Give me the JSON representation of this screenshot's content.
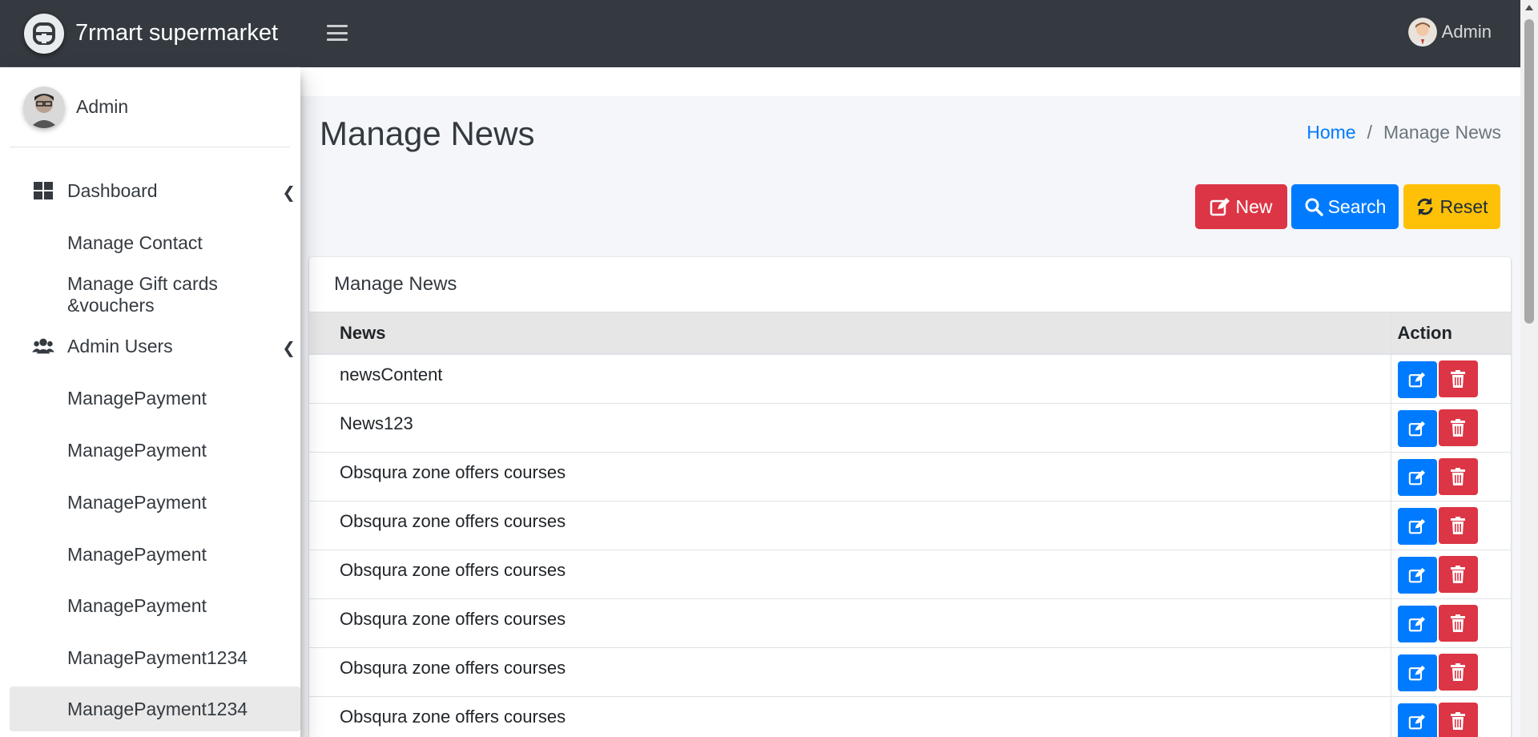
{
  "app": {
    "brand": "7rmart supermarket"
  },
  "topnav": {
    "user": "Admin"
  },
  "sidebar": {
    "user": "Admin",
    "items": [
      {
        "label": "Dashboard",
        "icon": "dashboard-icon",
        "has_children": true
      },
      {
        "label": "Manage Contact"
      },
      {
        "label": "Manage Gift cards &vouchers"
      },
      {
        "label": "Admin Users",
        "icon": "users-icon",
        "has_children": true
      },
      {
        "label": "ManagePayment"
      },
      {
        "label": "ManagePayment"
      },
      {
        "label": "ManagePayment"
      },
      {
        "label": "ManagePayment"
      },
      {
        "label": "ManagePayment"
      },
      {
        "label": "ManagePayment1234"
      },
      {
        "label": "ManagePayment1234",
        "active": true
      }
    ]
  },
  "page": {
    "title": "Manage News",
    "breadcrumb": {
      "home": "Home",
      "separator": "/",
      "current": "Manage News"
    }
  },
  "toolbar": {
    "new_label": "New",
    "search_label": "Search",
    "reset_label": "Reset"
  },
  "card": {
    "title": "Manage News",
    "columns": {
      "news": "News",
      "action": "Action"
    },
    "rows": [
      "newsContent",
      "News123",
      "Obsqura zone offers courses",
      "Obsqura zone offers courses",
      "Obsqura zone offers courses",
      "Obsqura zone offers courses",
      "Obsqura zone offers courses",
      "Obsqura zone offers courses"
    ]
  },
  "colors": {
    "navbar": "#343a40",
    "danger": "#dc3545",
    "primary": "#007bff",
    "warning": "#ffc107"
  }
}
